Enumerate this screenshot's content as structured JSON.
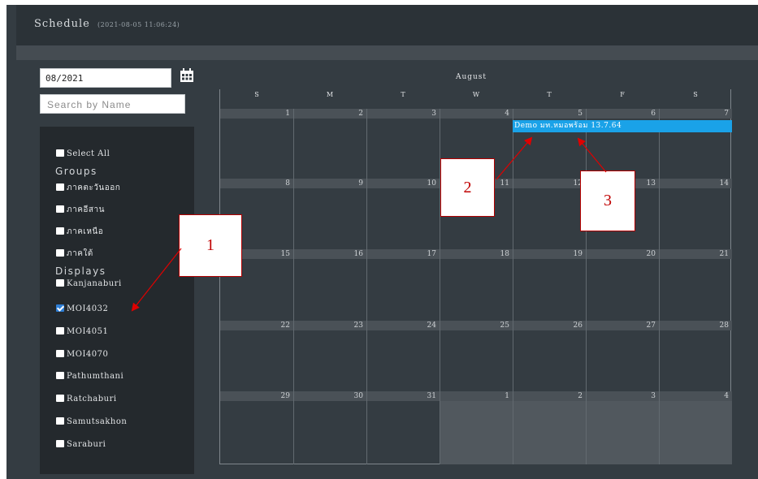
{
  "header": {
    "title": "Schedule",
    "timestamp": "(2021-08-05 11:06:24)"
  },
  "filters": {
    "month_value": "08/2021",
    "calendar_icon": "calendar-icon",
    "search_placeholder": "Search by Name",
    "select_all": {
      "label": "Select All",
      "checked": false
    },
    "groups_label": "Groups",
    "groups": [
      {
        "label": "ภาคตะวันออก",
        "checked": false
      },
      {
        "label": "ภาคอีสาน",
        "checked": false
      },
      {
        "label": "ภาคเหนือ",
        "checked": false
      },
      {
        "label": "ภาคใต้",
        "checked": false
      }
    ],
    "displays_label": "Displays",
    "displays": [
      {
        "label": "Kanjanaburi",
        "checked": false
      },
      {
        "label": "MOI4032",
        "checked": true
      },
      {
        "label": "MOI4051",
        "checked": false
      },
      {
        "label": "MOI4070",
        "checked": false
      },
      {
        "label": "Pathumthani",
        "checked": false
      },
      {
        "label": "Ratchaburi",
        "checked": false
      },
      {
        "label": "Samutsakhon",
        "checked": false
      },
      {
        "label": "Saraburi",
        "checked": false
      }
    ]
  },
  "calendar": {
    "month_title": "August",
    "weekdays": [
      "S",
      "M",
      "T",
      "W",
      "T",
      "F",
      "S"
    ],
    "weeks": [
      [
        "1",
        "2",
        "3",
        "4",
        "5",
        "6",
        "7"
      ],
      [
        "8",
        "9",
        "10",
        "11",
        "12",
        "13",
        "14"
      ],
      [
        "15",
        "16",
        "17",
        "18",
        "19",
        "20",
        "21"
      ],
      [
        "22",
        "23",
        "24",
        "25",
        "26",
        "27",
        "28"
      ],
      [
        "29",
        "30",
        "31",
        "1",
        "2",
        "3",
        "4"
      ]
    ],
    "event": {
      "title": "Demo มท.หมอพร้อม 13.7.64",
      "color": "#1aa2e8"
    }
  },
  "annotations": [
    {
      "label": "1"
    },
    {
      "label": "2"
    },
    {
      "label": "3"
    }
  ],
  "colors": {
    "panel_bg": "#24292d",
    "app_bg": "#343c42",
    "checked_box": "#2f7fd6",
    "annotation": "#e00000"
  }
}
